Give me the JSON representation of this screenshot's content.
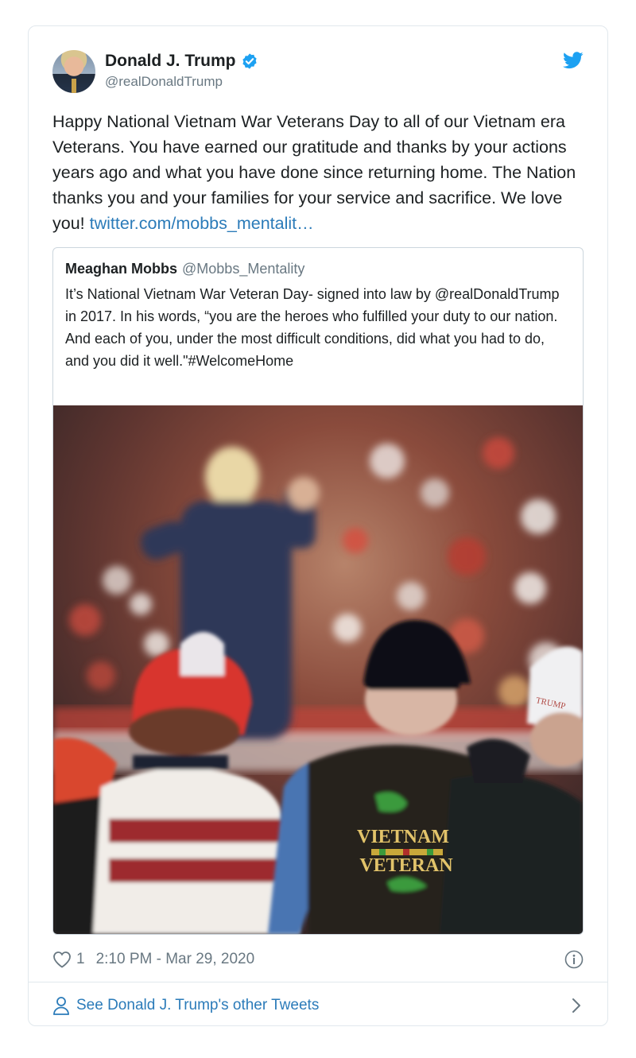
{
  "author": {
    "name": "Donald J. Trump",
    "handle": "@realDonaldTrump"
  },
  "tweet": {
    "text": "Happy National Vietnam War Veterans Day to all of our Vietnam era Veterans. You have earned our gratitude and thanks by your actions years ago and what you have done since returning home. The Nation thanks you and your families for your service and sacrifice. We love you! ",
    "link": "twitter.com/mobbs_mentalit…"
  },
  "quoted": {
    "name": "Meaghan Mobbs",
    "handle": "@Mobbs_Mentality",
    "text": "It’s National Vietnam War Veteran Day- signed into law by @realDonaldTrump in 2017. In his words, “you are the heroes who fulfilled your duty to our nation. And each of you, under the most difficult conditions, did what you had to do, and you did it well.\"#WelcomeHome",
    "photo": {
      "vest_line1": "VIETNAM",
      "vest_line2": "VETERAN",
      "hat_text": "TRUMP"
    }
  },
  "meta": {
    "like_count": "1",
    "timestamp": "2:10 PM - Mar 29, 2020"
  },
  "footer": {
    "see_more": "See Donald J. Trump's other Tweets"
  },
  "colors": {
    "link": "#2b7bb9",
    "verified": "#1da1f2",
    "border": "#e1e8ed"
  },
  "icons": [
    "verified-badge-icon",
    "twitter-bird-icon",
    "heart-icon",
    "info-icon",
    "person-icon",
    "chevron-right-icon"
  ]
}
